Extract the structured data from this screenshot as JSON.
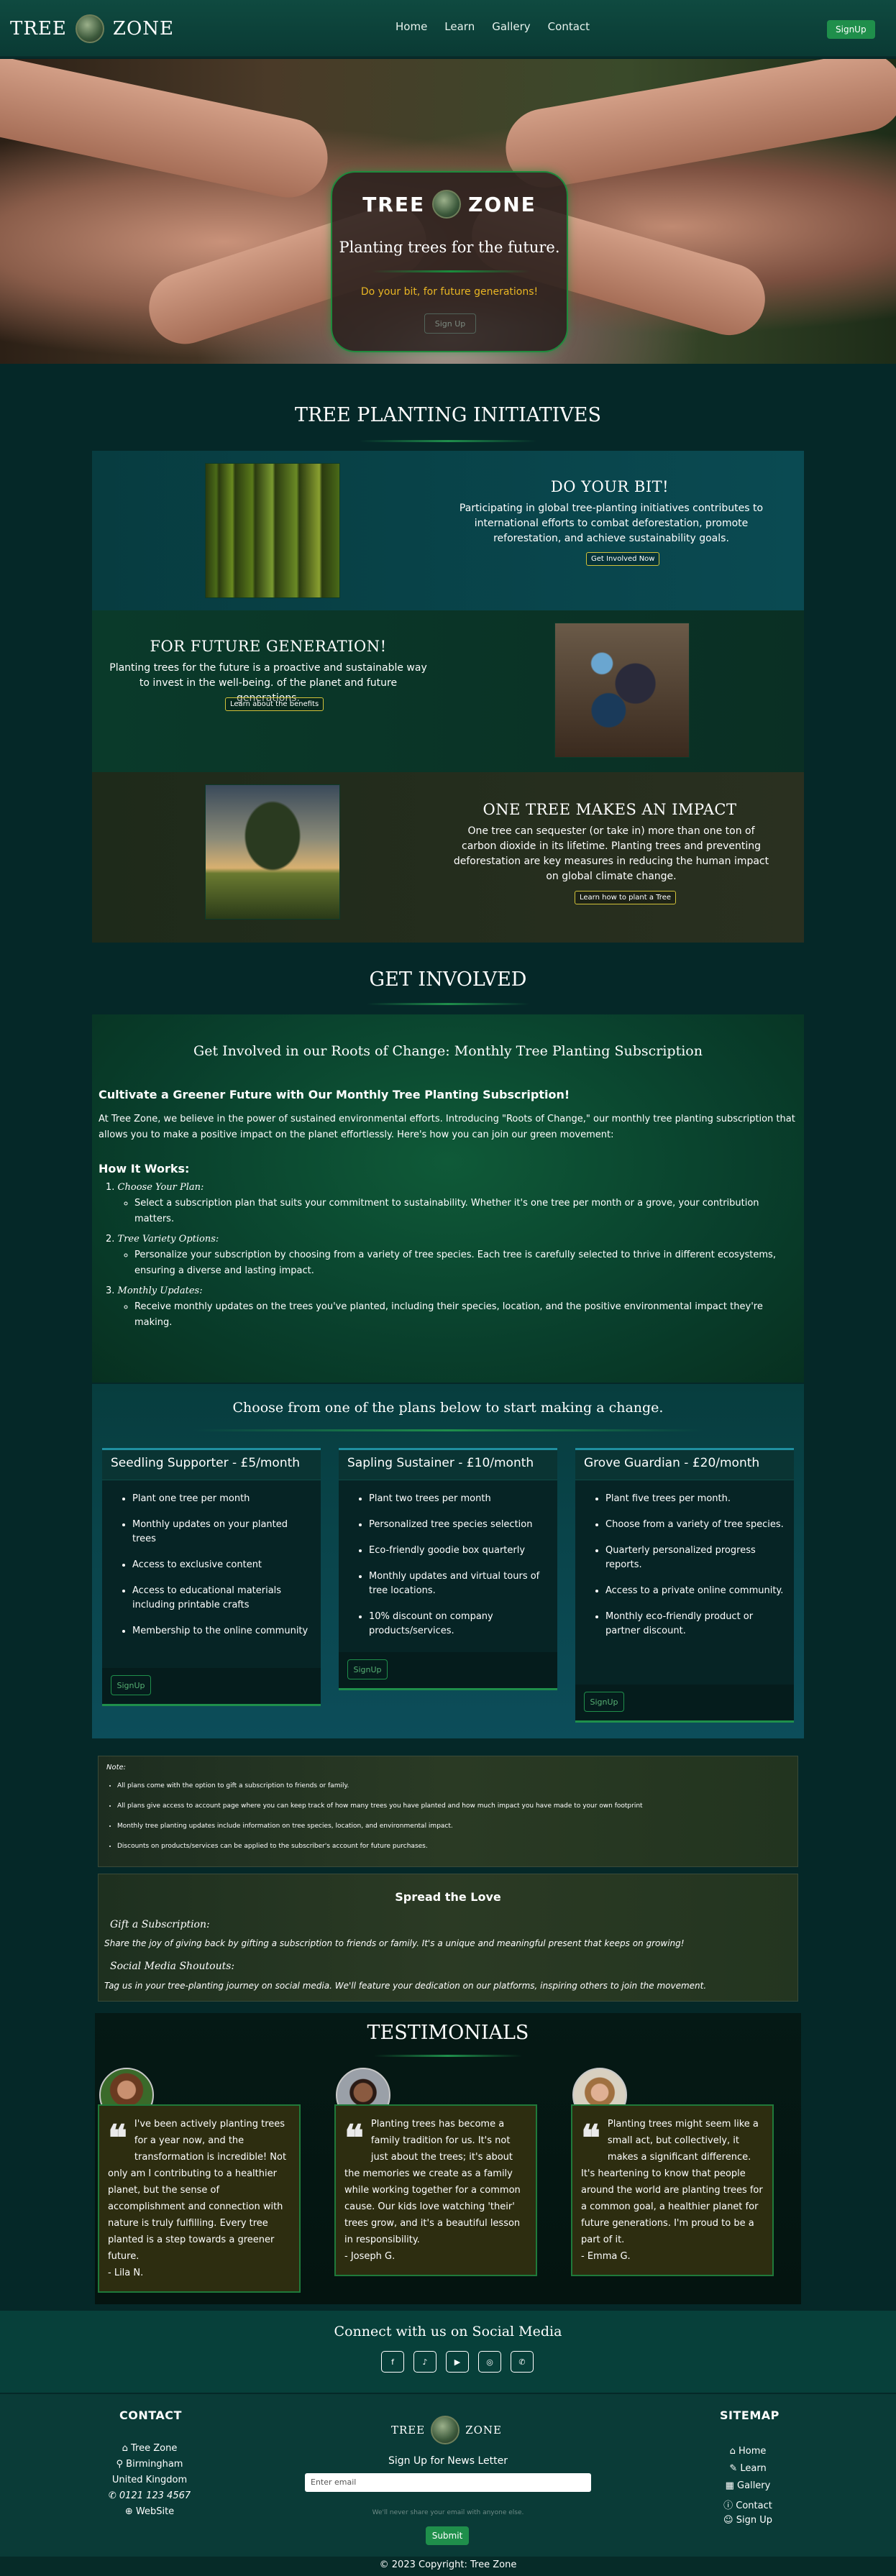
{
  "nav": {
    "brand_left": "TREE",
    "brand_right": "ZONE",
    "links": [
      "Home",
      "Learn",
      "Gallery",
      "Contact"
    ],
    "signup": "SignUp"
  },
  "hero": {
    "brand_left": "TREE",
    "brand_right": "ZONE",
    "tagline": "Planting trees for the future.",
    "sub": "Do your bit, for future generations!",
    "button": "Sign Up"
  },
  "initiatives": {
    "title": "TREE PLANTING INITIATIVES",
    "blocks": [
      {
        "title": "DO YOUR BIT!",
        "text": "Participating in global tree-planting initiatives contributes to international efforts to combat deforestation, promote reforestation, and achieve sustainability goals.",
        "button": "Get Involved Now"
      },
      {
        "title": "FOR FUTURE GENERATION!",
        "text": "Planting trees for the future is a proactive and sustainable way to invest in the well-being. of the planet and future generations.",
        "button": "Learn about the benefits"
      },
      {
        "title": "ONE TREE MAKES AN IMPACT",
        "text": "One tree can sequester (or take in) more than one ton of carbon dioxide in its lifetime. Planting trees and preventing deforestation are key measures in reducing the human impact on global climate change.",
        "button": "Learn how to plant a Tree"
      }
    ]
  },
  "involved": {
    "title": "GET INVOLVED",
    "subtitle": "Get Involved in our Roots of Change: Monthly Tree Planting Subscription",
    "heading": "Cultivate a Greener Future with Our Monthly Tree Planting Subscription!",
    "intro": "At Tree Zone, we believe in the power of sustained environmental efforts. Introducing \"Roots of Change,\" our monthly tree planting subscription that allows you to make a positive impact on the planet effortlessly. Here's how you can join our green movement:",
    "how": "How It Works:",
    "steps": [
      {
        "n": "1.",
        "title": "Choose Your Plan:",
        "text": "Select a subscription plan that suits your commitment to sustainability. Whether it's one tree per month or a grove, your contribution matters."
      },
      {
        "n": "2.",
        "title": "Tree Variety Options:",
        "text": "Personalize your subscription by choosing from a variety of tree species. Each tree is carefully selected to thrive in different ecosystems, ensuring a diverse and lasting impact."
      },
      {
        "n": "3.",
        "title": "Monthly Updates:",
        "text": "Receive monthly updates on the trees you've planted, including their species, location, and the positive environmental impact they're making."
      }
    ]
  },
  "plans": {
    "title": "Choose from one of the plans below to start making a change.",
    "items": [
      {
        "name": "Seedling Supporter - £5/month",
        "features": [
          "Plant one tree per month",
          "Monthly updates on your planted trees",
          "Access to exclusive content",
          "Access to educational materials including printable crafts",
          "Membership to the online community"
        ],
        "button": "SignUp"
      },
      {
        "name": "Sapling Sustainer - £10/month",
        "features": [
          "Plant two trees per month",
          "Personalized tree species selection",
          "Eco-friendly goodie box quarterly",
          "Monthly updates and virtual tours of tree locations.",
          "10% discount on company products/services."
        ],
        "button": "SignUp"
      },
      {
        "name": "Grove Guardian - £20/month",
        "features": [
          "Plant five trees per month.",
          "Choose from a variety of tree species.",
          "Quarterly personalized progress reports.",
          "Access to a private online community.",
          "Monthly eco-friendly product or partner discount."
        ],
        "button": "SignUp"
      }
    ]
  },
  "note": {
    "title": "Note:",
    "items": [
      "All plans come with the option to gift a subscription to friends or family.",
      "All plans give access to account page where you can keep track of how many trees you have planted and how much impact you have made to your own footprint",
      "Monthly tree planting updates include information on tree species, location, and environmental impact.",
      "Discounts on products/services can be applied to the subscriber's account for future purchases."
    ]
  },
  "spread": {
    "title": "Spread the Love",
    "gift_title": "Gift a Subscription:",
    "gift_text": "Share the joy of giving back by gifting a subscription to friends or family. It's a unique and meaningful present that keeps on growing!",
    "social_title": "Social Media Shoutouts:",
    "social_text": "Tag us in your tree-planting journey on social media. We'll feature your dedication on our platforms, inspiring others to join the movement."
  },
  "testimonials": {
    "title": "TESTIMONIALS",
    "items": [
      {
        "text": "I've been actively planting trees for a year now, and the transformation is incredible! Not only am I contributing to a healthier planet, but the sense of accomplishment and connection with nature is truly fulfilling. Every tree planted is a step towards a greener future.",
        "author": "- Lila N."
      },
      {
        "text": "Planting trees has become a family tradition for us. It's not just about the trees; it's about the memories we create as a family while working together for a common cause. Our kids love watching 'their' trees grow, and it's a beautiful lesson in responsibility.",
        "author": "- Joseph G."
      },
      {
        "text": "Planting trees might seem like a small act, but collectively, it makes a significant difference. It's heartening to know that people around the world are planting trees for a common goal, a healthier planet for future generations. I'm proud to be a part of it.",
        "author": "- Emma G."
      }
    ]
  },
  "social": {
    "title": "Connect with us on Social Media",
    "icons": [
      "facebook-icon",
      "tiktok-icon",
      "youtube-icon",
      "instagram-icon",
      "whatsapp-icon"
    ]
  },
  "footer": {
    "contact_title": "CONTACT",
    "contact": [
      "Tree Zone",
      "Birmingham",
      "United Kingdom",
      "0121 123 4567",
      "WebSite"
    ],
    "brand_left": "TREE",
    "brand_right": "ZONE",
    "newsletter": "Sign Up for News Letter",
    "email_placeholder": "Enter email",
    "privacy": "We'll never share your email with anyone else.",
    "submit": "Submit",
    "sitemap_title": "SITEMAP",
    "sitemap": [
      "Home",
      "Learn",
      "Gallery",
      "Contact",
      "Sign Up"
    ]
  },
  "copyright": "© 2023 Copyright: Tree Zone"
}
